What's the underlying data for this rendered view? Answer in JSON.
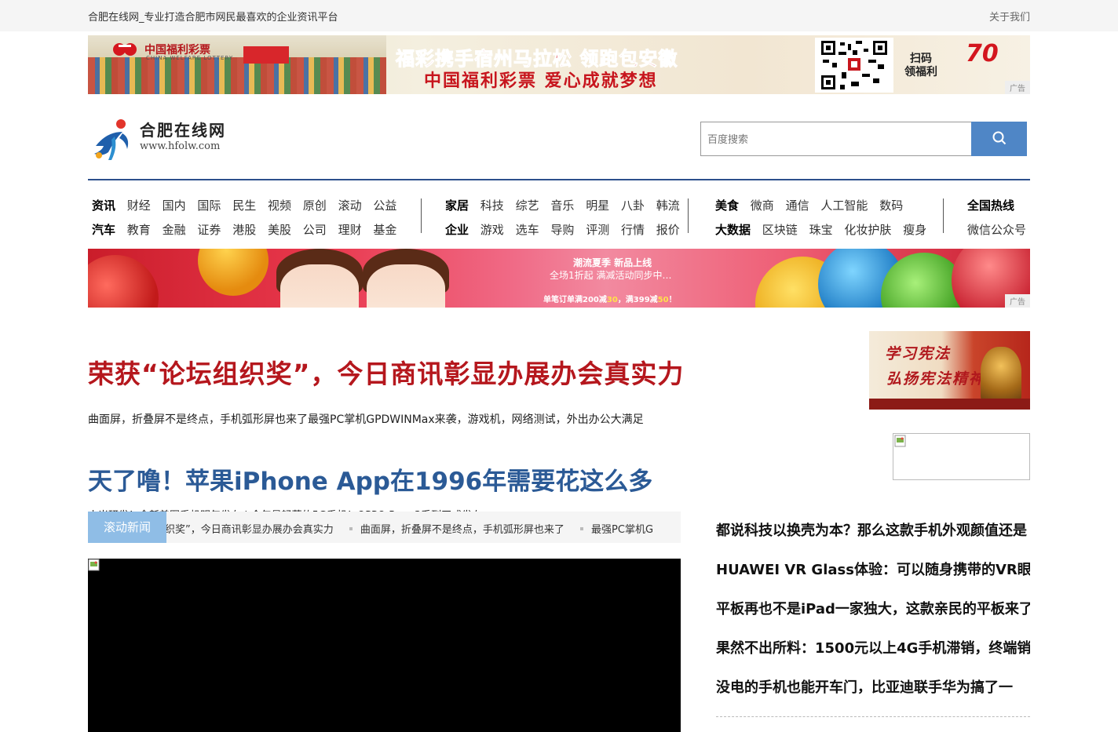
{
  "topbar": {
    "slogan": "合肥在线网_专业打造合肥市网民最喜欢的企业资讯平台",
    "about": "关于我们"
  },
  "ad_top": {
    "lottery_name": "中国福利彩票",
    "lottery_en": "CHINA WELFARE LOTTERY",
    "headline": "福彩携手宿州马拉松 领跑包安徽",
    "slogan": "中国福利彩票   爱心成就梦想",
    "scan": "扫码",
    "scan2": "领福利",
    "badge": "70",
    "tag": "广告"
  },
  "logo": {
    "name": "合肥在线网",
    "url": "www.hfolw.com"
  },
  "search": {
    "placeholder": "百度搜索"
  },
  "nav": {
    "g1": {
      "row1": [
        "资讯",
        "财经",
        "国内",
        "国际",
        "民生",
        "视频",
        "原创",
        "滚动",
        "公益"
      ],
      "row2": [
        "汽车",
        "教育",
        "金融",
        "证券",
        "港股",
        "美股",
        "公司",
        "理财",
        "基金"
      ]
    },
    "g2": {
      "row1": [
        "家居",
        "科技",
        "综艺",
        "音乐",
        "明星",
        "八卦",
        "韩流"
      ],
      "row2": [
        "企业",
        "游戏",
        "选车",
        "导购",
        "评测",
        "行情",
        "报价"
      ]
    },
    "g3": {
      "row1": [
        "美食",
        "微商",
        "通信",
        "人工智能",
        "数码"
      ],
      "row2": [
        "大数据",
        "区块链",
        "珠宝",
        "化妆护肤",
        "瘦身"
      ]
    },
    "g4": {
      "row1": [
        "全国热线"
      ],
      "row2": [
        "微信公众号"
      ]
    }
  },
  "ad_mid": {
    "line1": "潮流夏季  新品上线",
    "line2": "全场1折起  满减活动同步中…",
    "line3a": "单笔订单满200减",
    "line3b": "30",
    "line3c": "，满399减",
    "line3d": "50",
    "line3e": "！",
    "tag": "广告"
  },
  "headline1": {
    "title": "荣获“论坛组织奖”，今日商讯彰显办展办会真实力",
    "sub": "曲面屏，折叠屏不是终点，手机弧形屏也来了最强PC掌机GPDWINMax来袭，游戏机，网络测试，外出办公大满足"
  },
  "headline2": {
    "title": "天了噜！苹果iPhone App在1996年需要花这么多",
    "sub": "小米研发！全新美图手机明年发布 | 今年最轻薄的5G手机！OPPO Reno3系列正式发布"
  },
  "side_ad": {
    "line1": "学习宪法",
    "line2": "弘扬宪法精神"
  },
  "ticker": {
    "tag": "滚动新闻",
    "items": [
      "织奖”，今日商讯彰显办展办会真实力",
      "曲面屏，折叠屏不是终点，手机弧形屏也来了",
      "最强PC掌机G"
    ]
  },
  "right_list": [
    "都说科技以换壳为本？那么这款手机外观颜值还是",
    "HUAWEI VR Glass体验：可以随身携带的VR眼",
    "平板再也不是iPad一家独大，这款亲民的平板来了",
    "果然不出所料：1500元以上4G手机滞销，终端销",
    "没电的手机也能开车门，比亚迪联手华为搞了一"
  ],
  "colors": {
    "accent_red": "#b5171d",
    "accent_blue": "#2b5a96",
    "search_button": "#4f86c6",
    "ticker_tag": "#8fbde6"
  }
}
